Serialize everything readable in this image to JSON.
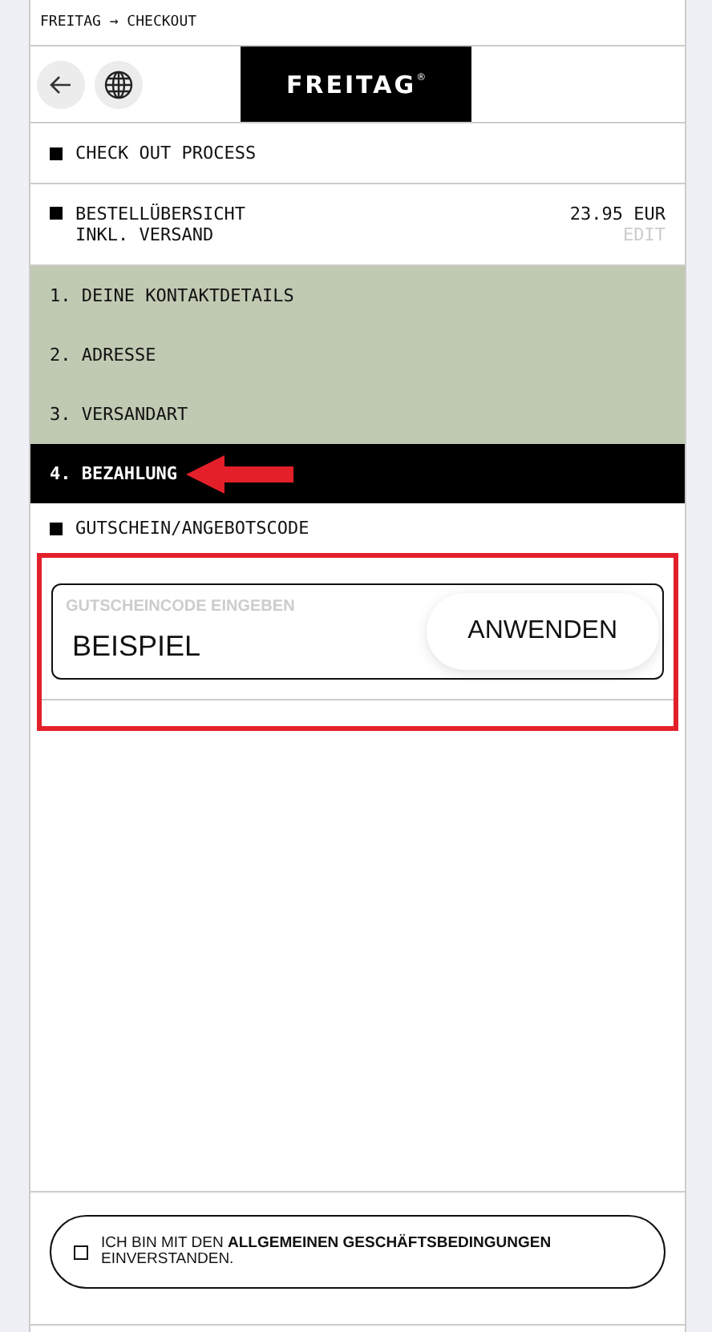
{
  "breadcrumb": "FREITAG → CHECKOUT",
  "header": {
    "logo": "FREITAG",
    "logo_mark": "®"
  },
  "process_title": "CHECK OUT PROCESS",
  "summary": {
    "title": "BESTELLÜBERSICHT",
    "subtitle": "INKL. VERSAND",
    "price": "23.95 EUR",
    "edit": "EDIT"
  },
  "steps": [
    {
      "label": "1. DEINE KONTAKTDETAILS",
      "selected": false
    },
    {
      "label": "2. ADRESSE",
      "selected": false
    },
    {
      "label": "3. VERSANDART",
      "selected": false
    },
    {
      "label": "4. BEZAHLUNG",
      "selected": true
    }
  ],
  "voucher": {
    "title": "GUTSCHEIN/ANGEBOTSCODE",
    "placeholder": "GUTSCHEINCODE EINGEBEN",
    "value": "BEISPIEL",
    "button": "ANWENDEN"
  },
  "terms": {
    "text": "ICH BIN MIT DEN **ALLGEMEINEN GESCHÄFTSBEDINGUNGEN** EINVERSTANDEN.",
    "checked": false
  }
}
